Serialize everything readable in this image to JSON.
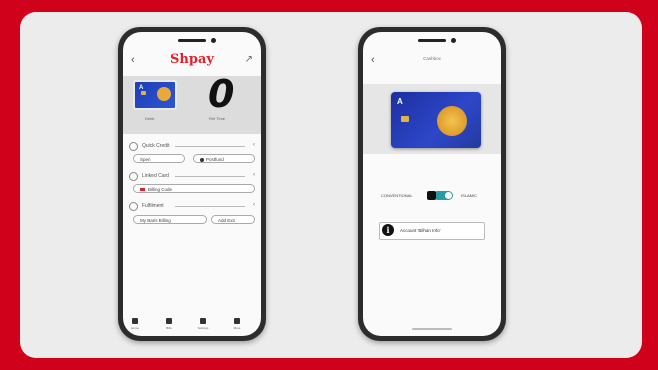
{
  "phone1": {
    "brand": "Shpay",
    "balance_big": "0",
    "card_caption": "Debit",
    "balance_caption": "Ref Time",
    "rows": [
      {
        "label": "Quick Credit",
        "pill_left": "Spen",
        "pill_right": "Postfund"
      },
      {
        "label": "Linked Card",
        "pill": "Billing Code"
      },
      {
        "label": "Fulfilment",
        "pill_left": "My Baris Billing",
        "pill_right": "Add Exit"
      }
    ],
    "nav": [
      "Home",
      "Bills",
      "Settings",
      "More"
    ]
  },
  "phone2": {
    "title": "Cashbox",
    "card_logo": "A",
    "toggle_left": "CONVENTIONAL",
    "toggle_right": "ISLAMIC",
    "info_button": "Account 'Bilhan Info'"
  },
  "colors": {
    "background": "#d0021b",
    "brand": "#e4202b",
    "card": "#1d2fa0",
    "toggle": "#2a9aa5"
  }
}
